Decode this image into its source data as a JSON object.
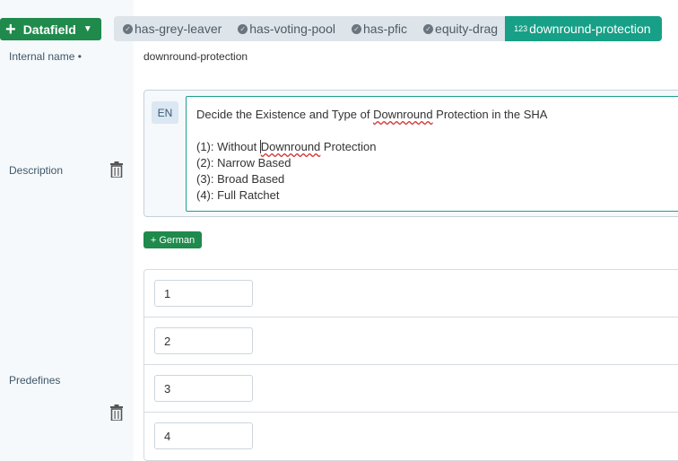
{
  "toolbar": {
    "datafield_label": "Datafield"
  },
  "tabs": [
    {
      "label": "has-grey-leaver",
      "icon": "check-circle-icon"
    },
    {
      "label": "has-voting-pool",
      "icon": "check-circle-icon"
    },
    {
      "label": "has-pfic",
      "icon": "check-circle-icon"
    },
    {
      "label": "equity-drag",
      "icon": "check-circle-icon"
    },
    {
      "label": "downround-protection",
      "icon": "number-type-icon",
      "icon_text": "123",
      "active": true
    }
  ],
  "internal_name": {
    "label": "Internal name •",
    "value": "downround-protection"
  },
  "description": {
    "label": "Description",
    "language": "EN",
    "lines": [
      "Decide the Existence and Type of Downround Protection in the SHA",
      "",
      "(1): Without Downround Protection",
      "(2): Narrow Based",
      "(3): Broad Based",
      "(4): Full Ratchet"
    ],
    "add_language_label": "+ German"
  },
  "predefines": {
    "label": "Predefines",
    "values": [
      "1",
      "2",
      "3",
      "4"
    ]
  },
  "colors": {
    "primary_green": "#1f8a4c",
    "active_tab": "#17a087",
    "panel_bg": "#f5f9fc"
  }
}
